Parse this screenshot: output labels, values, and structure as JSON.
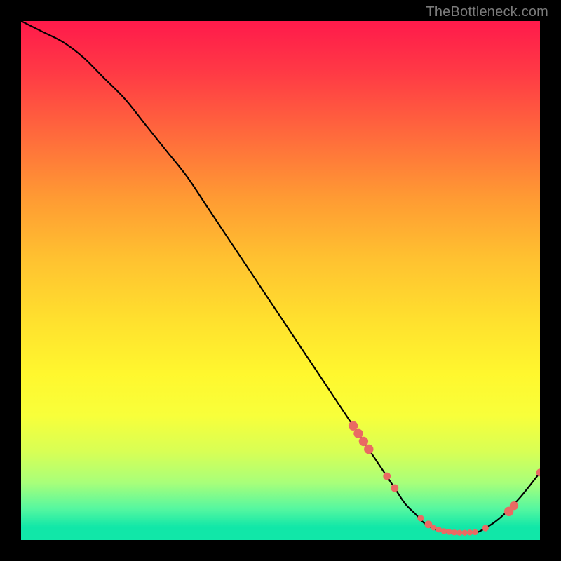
{
  "watermark": "TheBottleneck.com",
  "colors": {
    "background": "#000000",
    "curve": "#000000",
    "marker": "#e96a63"
  },
  "chart_data": {
    "type": "line",
    "title": "",
    "xlabel": "",
    "ylabel": "",
    "xlim": [
      0,
      100
    ],
    "ylim": [
      0,
      100
    ],
    "grid": false,
    "legend": false,
    "series": [
      {
        "name": "bottleneck-curve",
        "x": [
          0,
          4,
          8,
          12,
          16,
          20,
          24,
          28,
          32,
          36,
          40,
          44,
          48,
          52,
          56,
          60,
          64,
          68,
          70,
          72,
          74,
          76,
          78,
          80,
          82,
          84,
          86,
          88,
          92,
          96,
          100
        ],
        "y": [
          100,
          98,
          96,
          93,
          89,
          85,
          80,
          75,
          70,
          64,
          58,
          52,
          46,
          40,
          34,
          28,
          22,
          16,
          13,
          10,
          7,
          5,
          3,
          2,
          1.5,
          1.3,
          1.3,
          1.5,
          4,
          8,
          13
        ]
      }
    ],
    "markers": [
      {
        "x": 64,
        "y": 22,
        "r": 6.7
      },
      {
        "x": 65,
        "y": 20.5,
        "r": 6.7
      },
      {
        "x": 66,
        "y": 19,
        "r": 6.7
      },
      {
        "x": 67,
        "y": 17.5,
        "r": 6.7
      },
      {
        "x": 70.5,
        "y": 12.3,
        "r": 5.4
      },
      {
        "x": 72,
        "y": 10,
        "r": 5.4
      },
      {
        "x": 77,
        "y": 4.2,
        "r": 4.6
      },
      {
        "x": 78.5,
        "y": 3.0,
        "r": 5.4
      },
      {
        "x": 79.5,
        "y": 2.4,
        "r": 4.2
      },
      {
        "x": 80.5,
        "y": 2.0,
        "r": 4.2
      },
      {
        "x": 81.5,
        "y": 1.7,
        "r": 4.2
      },
      {
        "x": 82.5,
        "y": 1.55,
        "r": 4.2
      },
      {
        "x": 83.5,
        "y": 1.45,
        "r": 4.2
      },
      {
        "x": 84.5,
        "y": 1.4,
        "r": 4.2
      },
      {
        "x": 85.5,
        "y": 1.4,
        "r": 4.2
      },
      {
        "x": 86.5,
        "y": 1.45,
        "r": 4.2
      },
      {
        "x": 87.5,
        "y": 1.5,
        "r": 4.2
      },
      {
        "x": 89.5,
        "y": 2.3,
        "r": 4.6
      },
      {
        "x": 94,
        "y": 5.5,
        "r": 6.7
      },
      {
        "x": 95,
        "y": 6.6,
        "r": 6.2
      },
      {
        "x": 100,
        "y": 13,
        "r": 5.4
      }
    ]
  }
}
